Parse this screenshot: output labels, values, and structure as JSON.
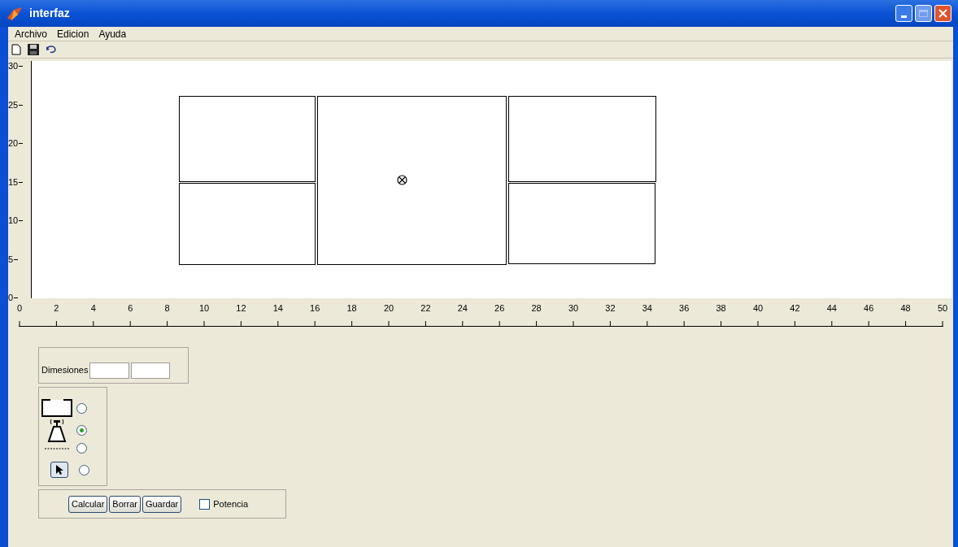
{
  "window": {
    "title": "interfaz"
  },
  "menu": [
    "Archivo",
    "Edicion",
    "Ayuda"
  ],
  "y_axis": [
    "30",
    "25",
    "20",
    "15",
    "10",
    "5",
    "0"
  ],
  "x_axis": [
    "0",
    "2",
    "4",
    "6",
    "8",
    "10",
    "12",
    "14",
    "16",
    "18",
    "20",
    "22",
    "24",
    "26",
    "28",
    "30",
    "32",
    "34",
    "36",
    "38",
    "40",
    "42",
    "44",
    "46",
    "48",
    "50"
  ],
  "dimensions": {
    "label": "Dimesiones"
  },
  "tools": [
    {
      "kind": "rectangle",
      "selected": false
    },
    {
      "kind": "antenna",
      "selected": true
    },
    {
      "kind": "dashed",
      "selected": false
    },
    {
      "kind": "pointer",
      "selected": false
    }
  ],
  "buttons": [
    "Calcular",
    "Borrar",
    "Guardar"
  ],
  "potencia": {
    "label": "Potencia",
    "checked": false
  }
}
